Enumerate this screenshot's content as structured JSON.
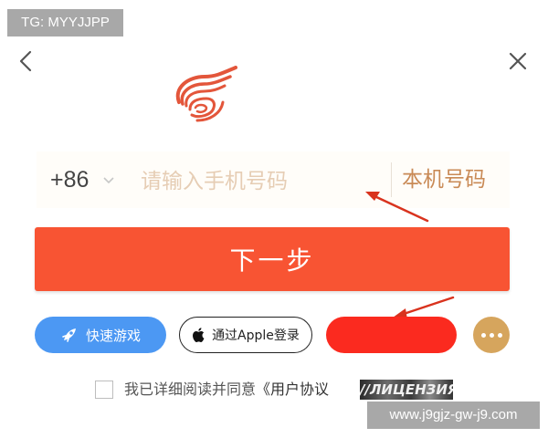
{
  "overlay": {
    "tg_label": "TG: MYYJJPP",
    "site_label": "www.j9gjz-gw-j9.com"
  },
  "header": {
    "back_icon": "chevron-left-icon",
    "close_icon": "close-icon",
    "logo": "netease-logo"
  },
  "phone": {
    "country_code": "+86",
    "placeholder": "请输入手机号码",
    "value": "",
    "local_number_label": "本机号码"
  },
  "next_button": {
    "label": "下一步"
  },
  "login_options": {
    "quick_game_label": "快速游戏",
    "apple_label": "通过Apple登录",
    "more_icon": "more-dots-icon"
  },
  "agreement": {
    "checked": false,
    "prefix": "我已详细阅读并同意",
    "link_text": "《用户协议",
    "stamp_text": "//ЛИЦЕНЗИЯ"
  },
  "colors": {
    "primary": "#f85433",
    "quick": "#4c98f3",
    "red": "#fb2a1f",
    "more": "#d6a55d",
    "accent_text": "#c98a56"
  }
}
